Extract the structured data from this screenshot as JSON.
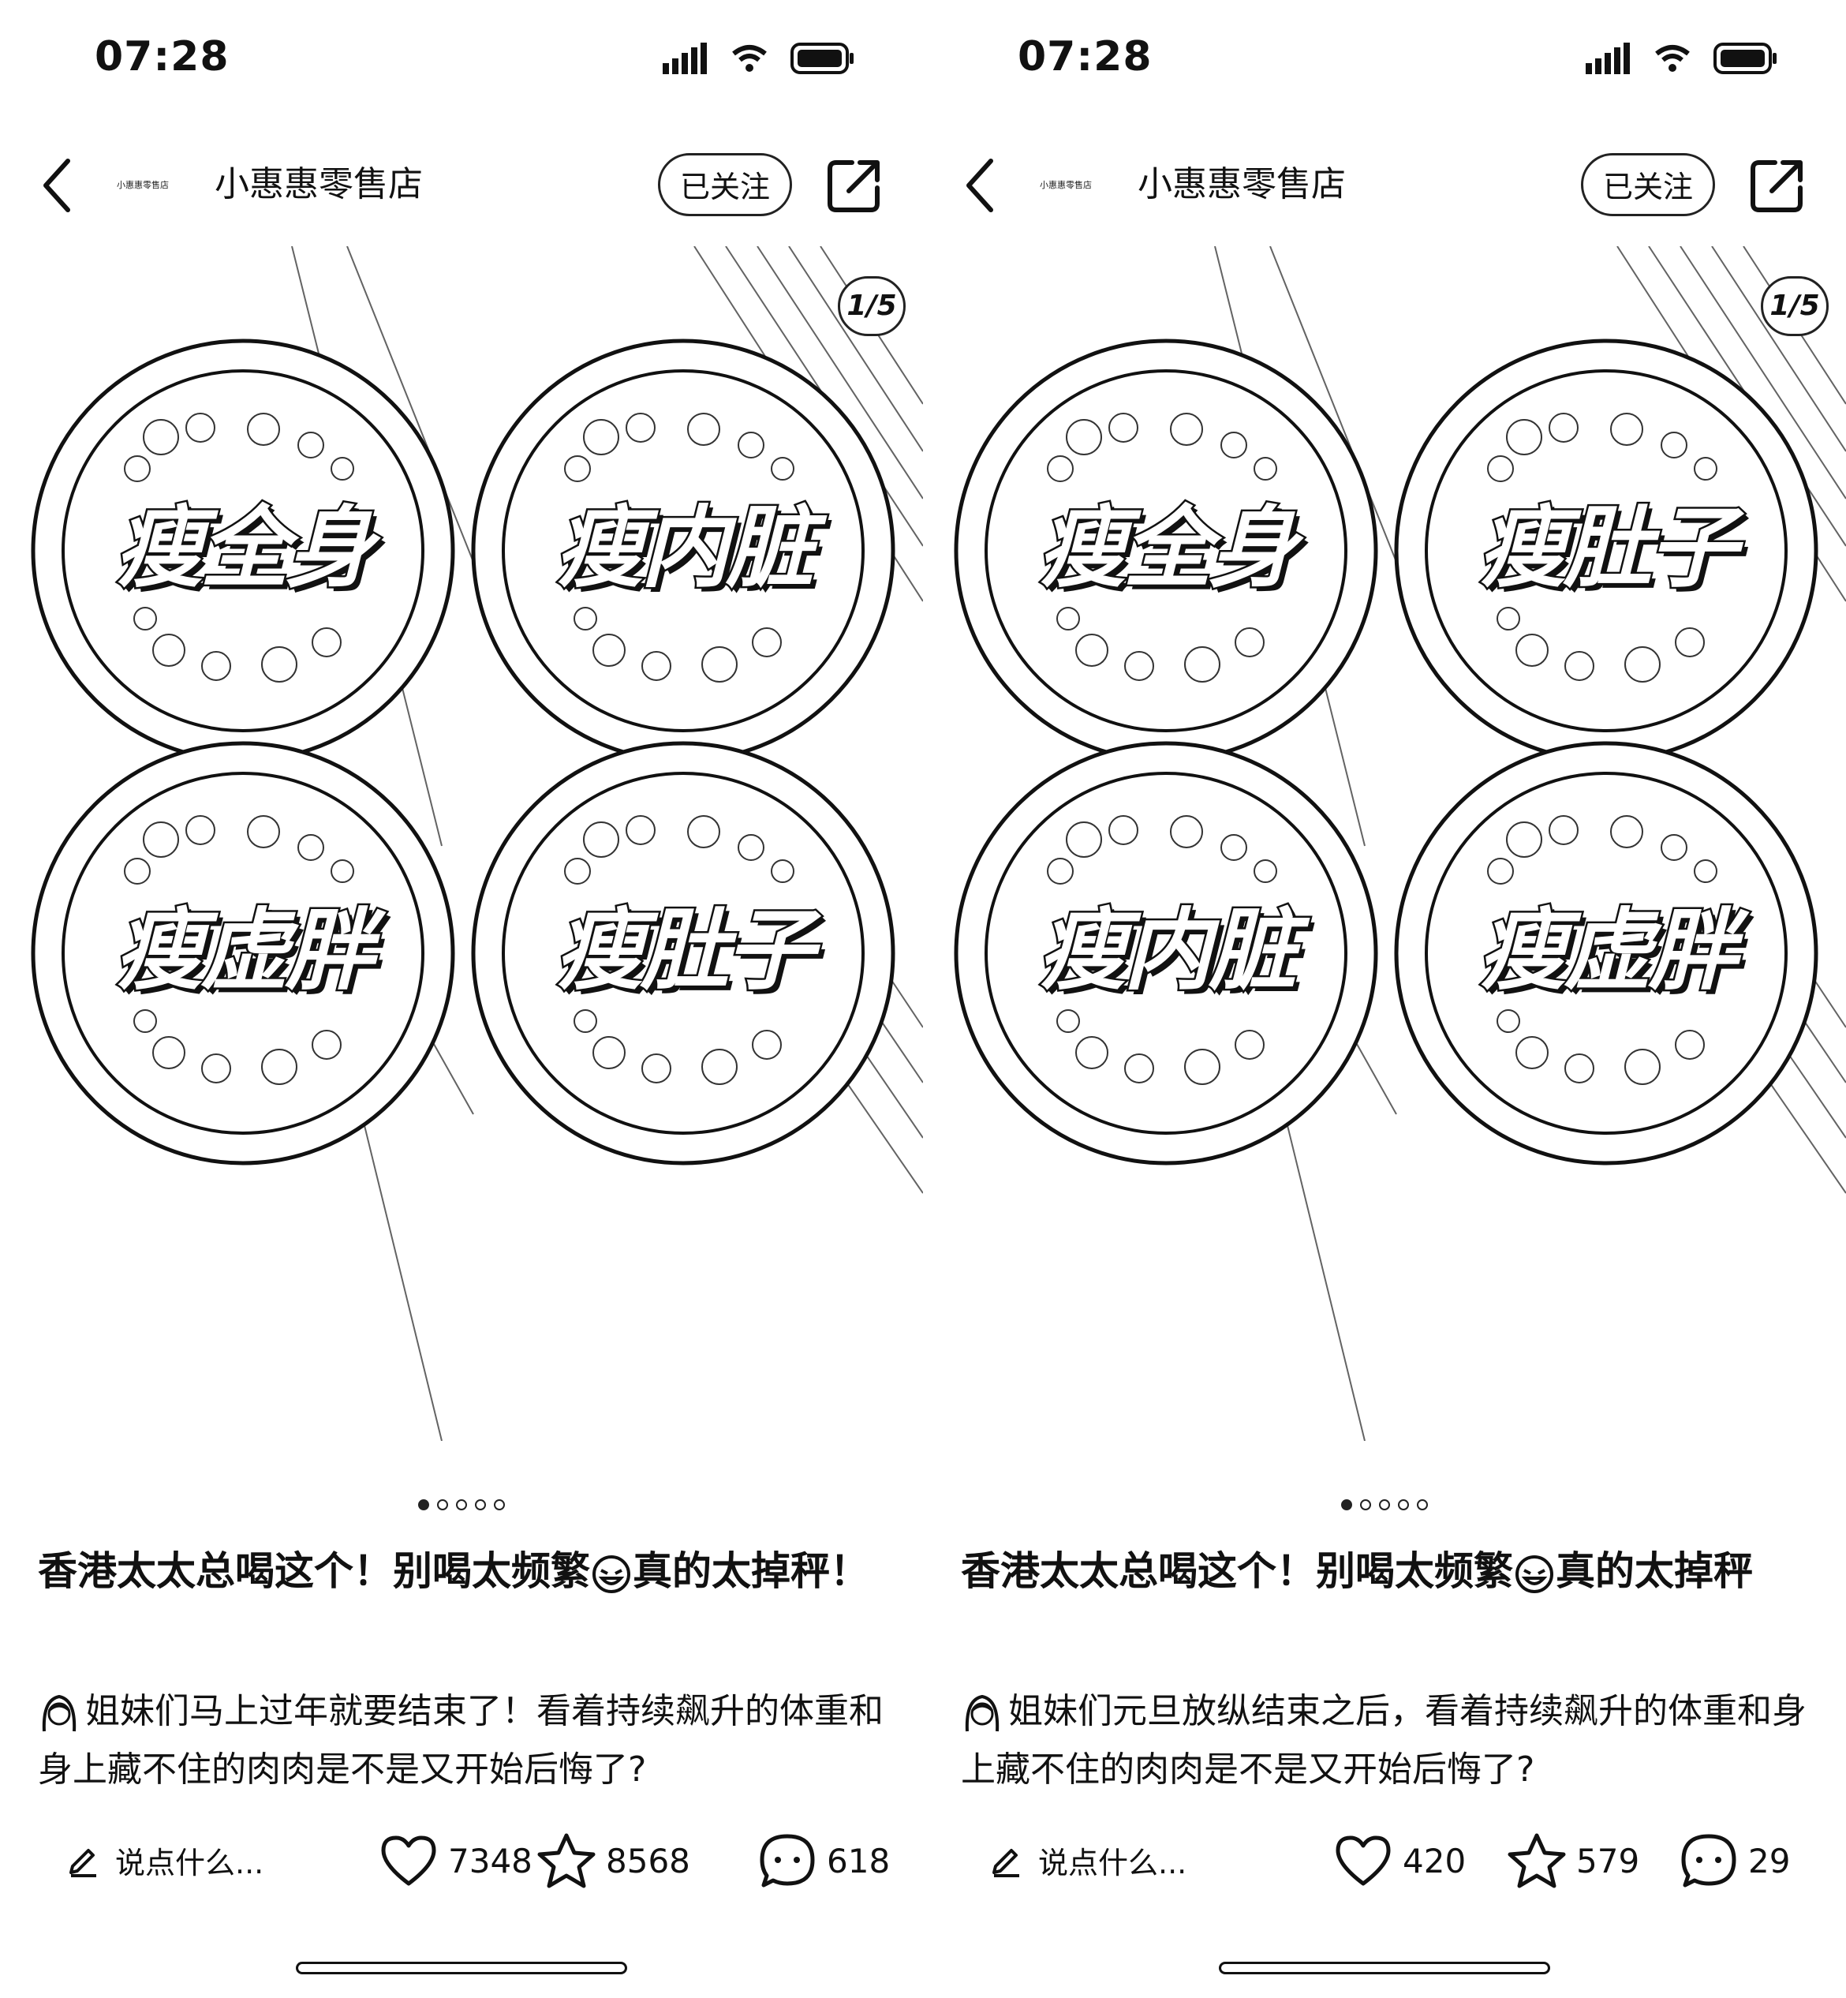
{
  "panels": [
    {
      "status_time": "07:28",
      "shop_logo_text": "小惠惠零售店",
      "shop_name": "小惠惠零售店",
      "follow_label": "已关注",
      "image_counter": "1/5",
      "plates": [
        "瘦全身",
        "瘦内脏",
        "瘦虚胖",
        "瘦肚子"
      ],
      "carousel_total": 5,
      "carousel_active": 1,
      "title_part1": "香港太太总喝这个！别喝太频繁",
      "title_part2": "真的太掉秤！",
      "desc": "姐妹们马上过年就要结束了！看着持续飙升的体重和身上藏不住的肉肉是不是又开始后悔了?",
      "comment_placeholder": "说点什么...",
      "likes": "7348",
      "favorites": "8568",
      "comments": "618"
    },
    {
      "status_time": "07:28",
      "shop_logo_text": "小惠惠零售店",
      "shop_name": "小惠惠零售店",
      "follow_label": "已关注",
      "image_counter": "1/5",
      "plates": [
        "瘦全身",
        "瘦肚子",
        "瘦内脏",
        "瘦虚胖"
      ],
      "carousel_total": 5,
      "carousel_active": 1,
      "title_part1": "香港太太总喝这个！别喝太频繁",
      "title_part2": "真的太掉秤",
      "desc": "姐妹们元旦放纵结束之后，看着持续飙升的体重和身上藏不住的肉肉是不是又开始后悔了?",
      "comment_placeholder": "说点什么...",
      "likes": "420",
      "favorites": "579",
      "comments": "29"
    }
  ]
}
